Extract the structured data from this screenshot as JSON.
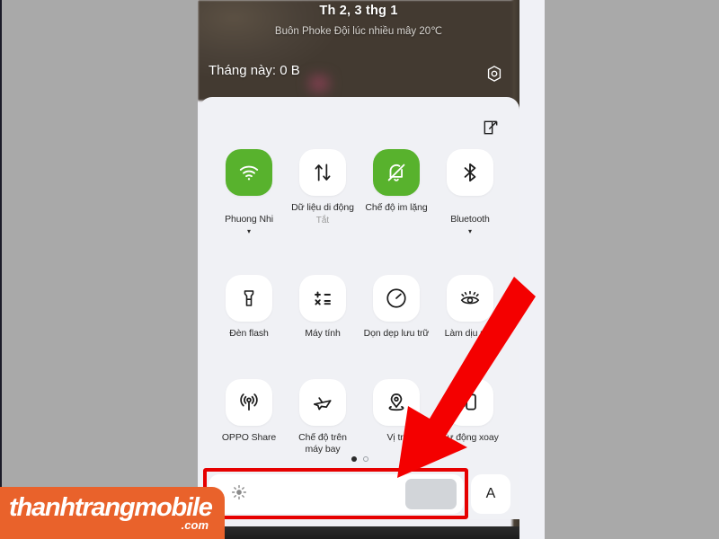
{
  "statusbar": {
    "date": "Th 2, 3 thg 1",
    "weather": "Buôn Phoke Đội lúc nhiều mây 20℃",
    "data_usage": "Tháng này: 0 B",
    "gear_icon": "settings-gear-icon"
  },
  "panel": {
    "edit_icon": "edit-square-icon",
    "tiles": [
      {
        "label": "Phuong Nhi",
        "caret": "▾",
        "sub": "",
        "state": "on",
        "icon": "wifi-icon"
      },
      {
        "label": "Dữ liệu di động",
        "caret": "",
        "sub": "Tắt",
        "state": "off",
        "icon": "mobile-data-icon"
      },
      {
        "label": "Chế độ im lặng",
        "caret": "",
        "sub": "",
        "state": "on",
        "icon": "bell-muted-icon"
      },
      {
        "label": "Bluetooth",
        "caret": "▾",
        "sub": "",
        "state": "off",
        "icon": "bluetooth-icon"
      },
      {
        "label": "Đèn flash",
        "caret": "",
        "sub": "",
        "state": "off",
        "icon": "flashlight-icon"
      },
      {
        "label": "Máy tính",
        "caret": "",
        "sub": "",
        "state": "off",
        "icon": "calculator-icon"
      },
      {
        "label": "Dọn dẹp lưu trữ",
        "caret": "",
        "sub": "",
        "state": "off",
        "icon": "gauge-icon"
      },
      {
        "label": "Làm dịu mắt",
        "caret": "",
        "sub": "",
        "state": "off",
        "icon": "eye-comfort-icon"
      },
      {
        "label": "OPPO Share",
        "caret": "",
        "sub": "",
        "state": "off",
        "icon": "broadcast-icon"
      },
      {
        "label": "Chế độ trên\nmáy bay",
        "caret": "",
        "sub": "",
        "state": "off",
        "icon": "airplane-icon"
      },
      {
        "label": "Vị trí",
        "caret": "",
        "sub": "",
        "state": "off",
        "icon": "location-pin-icon"
      },
      {
        "label": "Tự động xoay",
        "caret": "",
        "sub": "",
        "state": "off",
        "icon": "auto-rotate-icon"
      }
    ],
    "pages": {
      "total": 2,
      "active": 1
    }
  },
  "brightness": {
    "sun_icon": "brightness-sun-icon",
    "value_percent": 83,
    "auto_label": "A"
  },
  "watermark": {
    "name": "thanhtrangmobile",
    "tld": ".com"
  },
  "colors": {
    "accent_green": "#58b22d",
    "annotation_red": "#e60000",
    "watermark_orange": "#e9622b",
    "panel_bg": "#f0f1f5"
  }
}
